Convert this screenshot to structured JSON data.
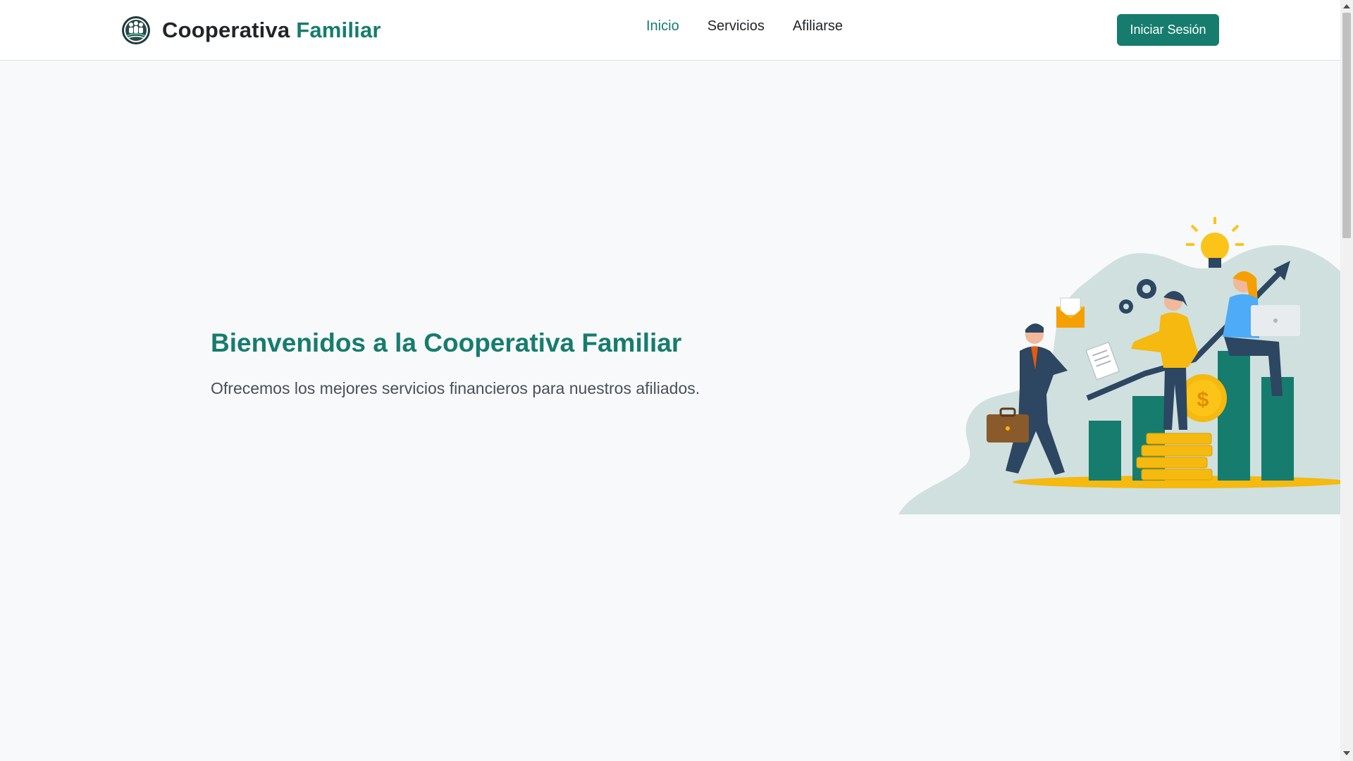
{
  "header": {
    "brand_main": "Cooperativa",
    "brand_accent": "Familiar",
    "logo_icon": "community-logo-icon",
    "nav": [
      {
        "label": "Inicio",
        "active": true
      },
      {
        "label": "Servicios",
        "active": false
      },
      {
        "label": "Afiliarse",
        "active": false
      }
    ],
    "login_label": "Iniciar Sesión"
  },
  "hero": {
    "title": "Bienvenidos a la Cooperativa Familiar",
    "subtitle": "Ofrecemos los mejores servicios financieros para nuestros afiliados.",
    "illustration_icon": "business-growth-illustration"
  },
  "colors": {
    "accent": "#167c6e",
    "background": "#f8f9fa",
    "text": "#212529",
    "muted_text": "#495057",
    "illustration_gold": "#f5b90f",
    "illustration_navy": "#2d4661"
  }
}
